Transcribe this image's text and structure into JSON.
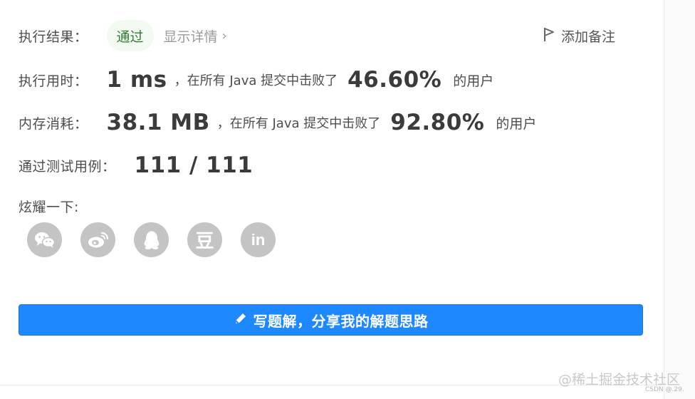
{
  "result": {
    "label": "执行结果：",
    "status": "通过",
    "detail_link": "显示详情",
    "chevron": "›",
    "note_label": "添加备注"
  },
  "runtime": {
    "label": "执行用时：",
    "value": "1 ms",
    "sep": "，在所有 Java 提交中击败了",
    "percent": "46.60%",
    "tail": "的用户"
  },
  "memory": {
    "label": "内存消耗：",
    "value": "38.1 MB",
    "sep": "，在所有 Java 提交中击败了",
    "percent": "92.80%",
    "tail": "的用户"
  },
  "tests": {
    "label": "通过测试用例：",
    "value": "111 / 111"
  },
  "share": {
    "label": "炫耀一下:",
    "icons": [
      "wechat-icon",
      "weibo-icon",
      "qq-icon",
      "douban-icon",
      "linkedin-icon"
    ],
    "douban_glyph": "豆",
    "linkedin_glyph": "in"
  },
  "cta": {
    "label": "写题解，分享我的解题思路"
  },
  "watermark": {
    "text": "@稀土掘金技术社区",
    "csdn": "CSDN @.29."
  },
  "colors": {
    "accent": "#1e88ff",
    "pass_text": "#2e7d32",
    "pass_bg": "#f3faf1",
    "icon_gray": "#c4c4c4"
  }
}
